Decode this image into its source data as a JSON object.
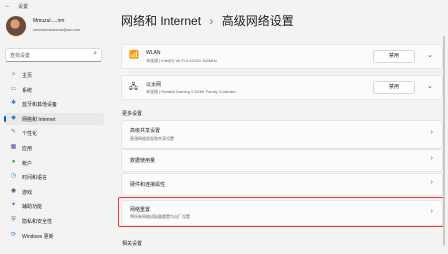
{
  "window": {
    "app_title": "设置"
  },
  "user": {
    "name": "Mmuzul.....nm",
    "email": "cmcosiculowsolo@aa.com"
  },
  "search": {
    "placeholder": "查找设置"
  },
  "sidebar": {
    "items": [
      {
        "label": "主页",
        "icon": "home-icon",
        "color": "#555555"
      },
      {
        "label": "系统",
        "icon": "system-icon",
        "color": "#2d7dd2"
      },
      {
        "label": "蓝牙和其他设备",
        "icon": "bluetooth-icon",
        "color": "#2d7dd2"
      },
      {
        "label": "网络和 Internet",
        "icon": "network-icon",
        "color": "#2d7dd2",
        "active": true
      },
      {
        "label": "个性化",
        "icon": "personalization-icon",
        "color": "#c0641c"
      },
      {
        "label": "应用",
        "icon": "apps-icon",
        "color": "#4a5aa8"
      },
      {
        "label": "帐户",
        "icon": "account-icon",
        "color": "#2a9d5a"
      },
      {
        "label": "时间和语言",
        "icon": "time-language-icon",
        "color": "#2d7dd2"
      },
      {
        "label": "游戏",
        "icon": "gaming-icon",
        "color": "#555555"
      },
      {
        "label": "辅助功能",
        "icon": "accessibility-icon",
        "color": "#2d7dd2"
      },
      {
        "label": "隐私和安全性",
        "icon": "shield-icon",
        "color": "#6b6b6b"
      },
      {
        "label": "Windows 更新",
        "icon": "windows-update-icon",
        "color": "#2d7dd2"
      }
    ]
  },
  "header": {
    "breadcrumb_parent": "网络和 Internet",
    "separator": "›",
    "title": "高级网络设置"
  },
  "adapters": [
    {
      "name": "WLAN",
      "detail": "未连接 | Intel(R) Wi-Fi 6 AX201 160MHz",
      "button": "禁用",
      "icon": "wifi-icon"
    },
    {
      "name": "以太网",
      "detail": "未连接 | Realtek Gaming 2.5GbE Family Controller",
      "button": "禁用",
      "icon": "ethernet-icon"
    }
  ],
  "more_settings": {
    "label": "更多设置",
    "items": [
      {
        "title": "高级共享设置",
        "subtitle": "更改网络发现和共享设置"
      },
      {
        "title": "数据使用量",
        "subtitle": ""
      },
      {
        "title": "硬件和连接属性",
        "subtitle": ""
      },
      {
        "title": "网络重置",
        "subtitle": "将所有网络适配器重置为出厂设置"
      }
    ]
  },
  "related": {
    "label": "相关设置"
  },
  "colors": {
    "accent": "#005fb8",
    "highlight": "#e0383b"
  }
}
